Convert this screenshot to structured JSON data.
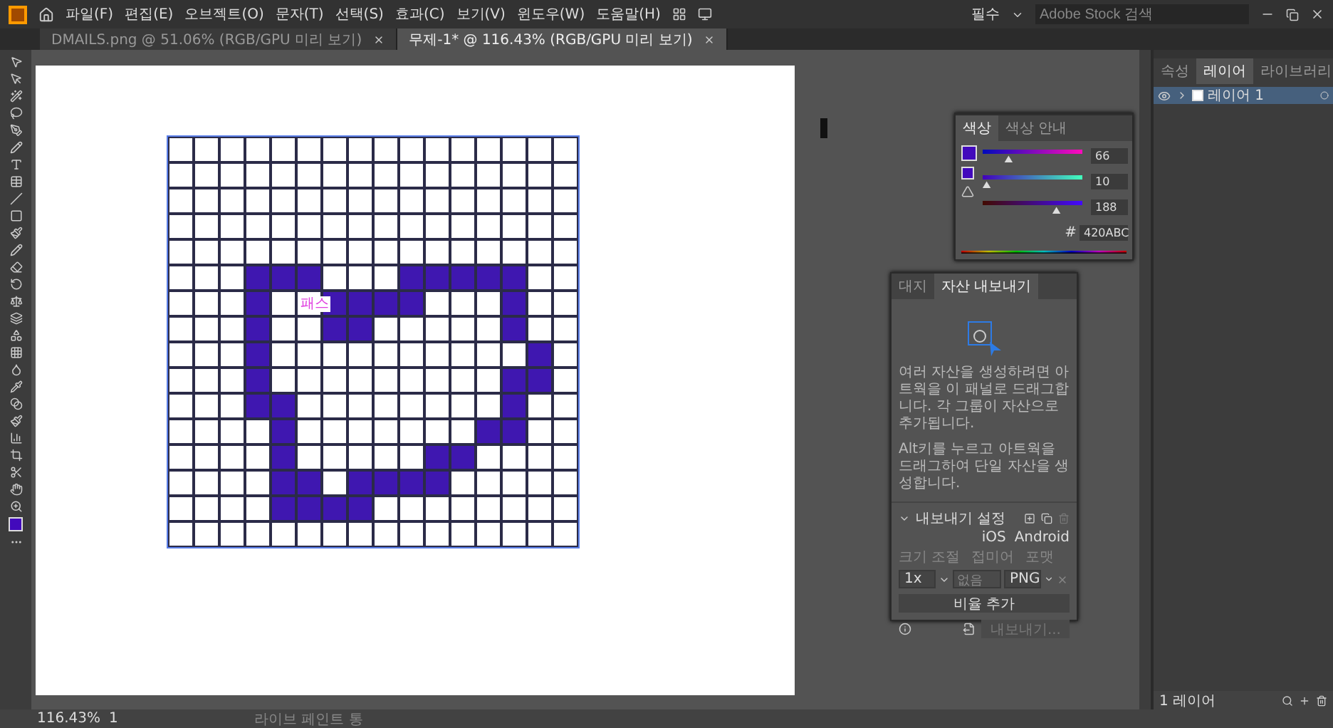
{
  "menu_bar": {
    "menus": [
      "파일(F)",
      "편집(E)",
      "오브젝트(O)",
      "문자(T)",
      "선택(S)",
      "효과(C)",
      "보기(V)",
      "윈도우(W)",
      "도움말(H)"
    ],
    "workspace": "필수",
    "stock_search": {
      "placeholder": "Adobe Stock 검색"
    }
  },
  "document_tabs": [
    {
      "label": "DMAILS.png @ 51.06% (RGB/GPU 미리 보기)",
      "selected": false
    },
    {
      "label": "무제-1* @ 116.43% (RGB/GPU 미리 보기)",
      "selected": true
    }
  ],
  "artboard": {
    "smart_guide": "패스",
    "pixel_rows": [
      [
        false,
        false,
        false,
        false,
        false,
        false,
        false,
        false,
        false,
        false,
        false,
        false,
        false,
        false,
        false,
        false
      ],
      [
        false,
        false,
        false,
        false,
        false,
        false,
        false,
        false,
        false,
        false,
        false,
        false,
        false,
        false,
        false,
        false
      ],
      [
        false,
        false,
        false,
        false,
        false,
        false,
        false,
        false,
        false,
        false,
        false,
        false,
        false,
        false,
        false,
        false
      ],
      [
        false,
        false,
        false,
        false,
        false,
        false,
        false,
        false,
        false,
        false,
        false,
        false,
        false,
        false,
        false,
        false
      ],
      [
        false,
        false,
        false,
        false,
        false,
        false,
        false,
        false,
        false,
        false,
        false,
        false,
        false,
        false,
        false,
        false
      ],
      [
        false,
        false,
        false,
        true,
        true,
        true,
        false,
        false,
        false,
        true,
        true,
        true,
        true,
        true,
        false,
        false
      ],
      [
        false,
        false,
        false,
        true,
        false,
        false,
        true,
        true,
        true,
        true,
        false,
        false,
        false,
        true,
        false,
        false
      ],
      [
        false,
        false,
        false,
        true,
        false,
        false,
        true,
        true,
        false,
        false,
        false,
        false,
        false,
        true,
        false,
        false
      ],
      [
        false,
        false,
        false,
        true,
        false,
        false,
        false,
        false,
        false,
        false,
        false,
        false,
        false,
        false,
        true,
        false
      ],
      [
        false,
        false,
        false,
        true,
        false,
        false,
        false,
        false,
        false,
        false,
        false,
        false,
        false,
        true,
        true,
        false
      ],
      [
        false,
        false,
        false,
        true,
        true,
        false,
        false,
        false,
        false,
        false,
        false,
        false,
        false,
        true,
        false,
        false
      ],
      [
        false,
        false,
        false,
        false,
        true,
        false,
        false,
        false,
        false,
        false,
        false,
        false,
        true,
        true,
        false,
        false
      ],
      [
        false,
        false,
        false,
        false,
        true,
        false,
        false,
        false,
        false,
        false,
        true,
        true,
        false,
        false,
        false,
        false
      ],
      [
        false,
        false,
        false,
        false,
        true,
        true,
        false,
        true,
        true,
        true,
        true,
        false,
        false,
        false,
        false,
        false
      ],
      [
        false,
        false,
        false,
        false,
        true,
        true,
        true,
        true,
        false,
        false,
        false,
        false,
        false,
        false,
        false,
        false
      ],
      [
        false,
        false,
        false,
        false,
        false,
        false,
        false,
        false,
        false,
        false,
        false,
        false,
        false,
        false,
        false,
        false
      ]
    ]
  },
  "color_panel": {
    "tabs": [
      {
        "label": "색상",
        "selected": true
      },
      {
        "label": "색상 안내",
        "selected": false
      }
    ],
    "channels": [
      {
        "level": 0.26,
        "value": "66"
      },
      {
        "level": 0.04,
        "value": "10"
      },
      {
        "level": 0.74,
        "value": "188"
      }
    ],
    "hex_prefix": "#",
    "hex": "420ABC"
  },
  "asset_panel": {
    "tabs": [
      {
        "label": "대지",
        "selected": false
      },
      {
        "label": "자산 내보내기",
        "selected": true
      }
    ],
    "instructions": [
      "여러 자산을 생성하려면 아트웍을 이 패널로 드래그합니다. 각 그룹이 자산으로 추가됩니다.",
      "Alt키를 누르고 아트웍을 드래그하여 단일 자산을 생성합니다."
    ],
    "export_settings": {
      "title": "내보내기 설정",
      "platforms": [
        "iOS",
        "Android"
      ],
      "columns": [
        "크기 조절",
        "접미어",
        "포맷"
      ],
      "scale": "1x",
      "suffix_placeholder": "없음",
      "format": "PNG",
      "add_button": "비율 추가"
    },
    "export_button": {
      "label": "내보내기...",
      "disabled": true
    }
  },
  "layers_panel": {
    "tabs": [
      {
        "label": "속성",
        "selected": false
      },
      {
        "label": "레이어",
        "selected": true
      },
      {
        "label": "라이브러리",
        "selected": false
      }
    ],
    "layers": [
      {
        "name": "레이어 1",
        "visible": true
      }
    ],
    "count": "1 레이어"
  },
  "status_bar": {
    "zoom": "116.43%",
    "artboard": "1",
    "tool": "라이브 페인트 통"
  }
}
